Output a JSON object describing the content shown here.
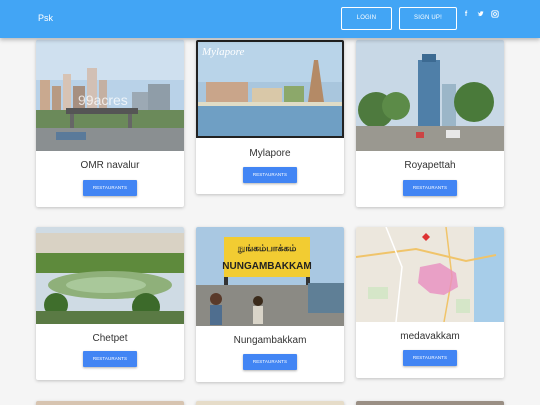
{
  "navbar": {
    "brand": "Psk",
    "login_label": "LOGIN",
    "signup_label": "SIGN UP!",
    "social_icons": [
      "facebook-icon",
      "twitter-icon",
      "instagram-icon"
    ]
  },
  "cards": [
    {
      "title": "OMR navalur",
      "button_label": "RESTAURANTS",
      "image_overlay": "99acres"
    },
    {
      "title": "Mylapore",
      "button_label": "RESTAURANTS",
      "image_overlay": "Mylapore"
    },
    {
      "title": "Royapettah",
      "button_label": "RESTAURANTS"
    },
    {
      "title": "Chetpet",
      "button_label": "RESTAURANTS"
    },
    {
      "title": "Nungambakkam",
      "button_label": "RESTAURANTS",
      "image_overlay_top": "நுங்கம்பாக்கம்",
      "image_overlay_bottom": "NUNGAMBAKKAM"
    },
    {
      "title": "medavakkam",
      "button_label": "RESTAURANTS"
    }
  ],
  "colors": {
    "navbar": "#42a5f5",
    "button": "#4285f4"
  }
}
